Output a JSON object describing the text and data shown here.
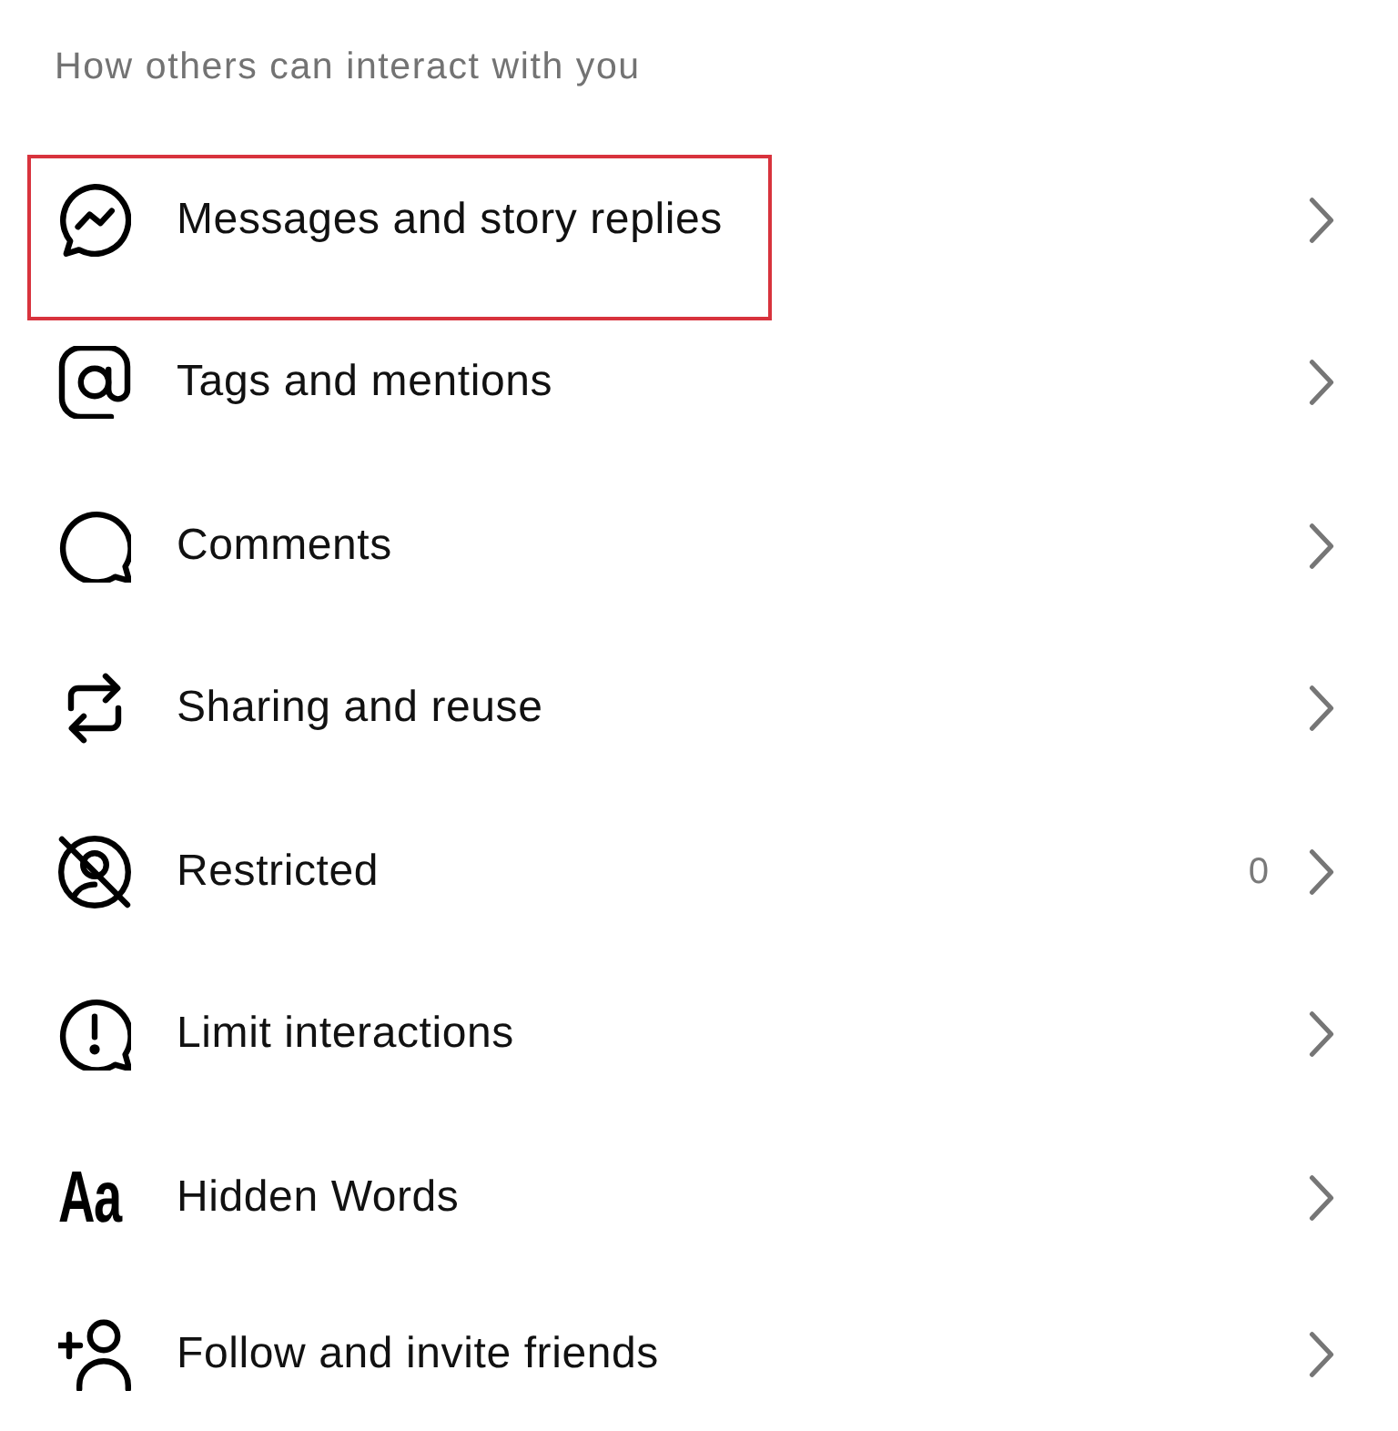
{
  "section": {
    "heading": "How others can interact with you"
  },
  "items": [
    {
      "label": "Messages and story replies",
      "highlighted": true
    },
    {
      "label": "Tags and mentions",
      "highlighted": false
    },
    {
      "label": "Comments",
      "highlighted": false
    },
    {
      "label": "Sharing and reuse",
      "highlighted": false
    },
    {
      "label": "Restricted",
      "highlighted": false,
      "count": "0"
    },
    {
      "label": "Limit interactions",
      "highlighted": false
    },
    {
      "label": "Hidden Words",
      "highlighted": false,
      "icon_text": "Aa"
    },
    {
      "label": "Follow and invite friends",
      "highlighted": false
    }
  ]
}
